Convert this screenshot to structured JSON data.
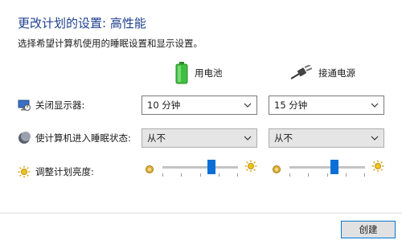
{
  "header": {
    "title": "更改计划的设置: 高性能",
    "subtitle": "选择希望计算机使用的睡眠设置和显示设置。"
  },
  "columns": {
    "battery_label": "用电池",
    "plugged_label": "接通电源",
    "battery_icon": "battery-icon",
    "plug_icon": "power-plug-icon"
  },
  "rows": {
    "display_off": {
      "label": "关闭显示器:",
      "battery_value": "10 分钟",
      "plugged_value": "15 分钟"
    },
    "sleep": {
      "label": "使计算机进入睡眠状态:",
      "battery_value": "从不",
      "plugged_value": "从不"
    },
    "brightness": {
      "label": "调整计划亮度:",
      "battery_level": 0.65,
      "plugged_level": 0.6
    }
  },
  "footer": {
    "create_label": "创建"
  },
  "colors": {
    "title": "#1e3f8f",
    "accent": "#0a6fd6"
  }
}
